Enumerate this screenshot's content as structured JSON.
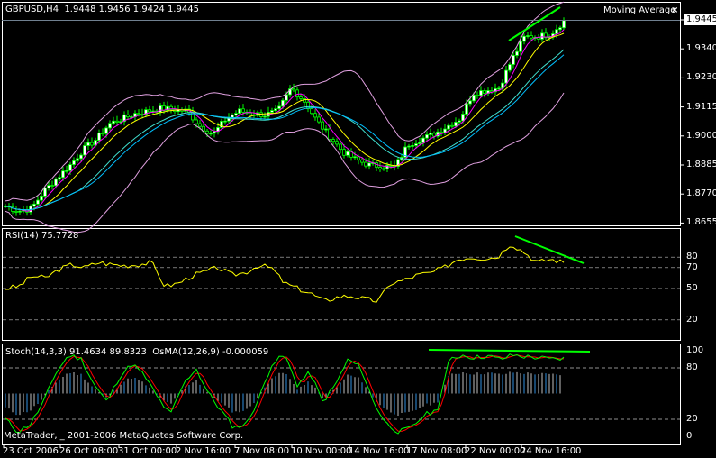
{
  "header": {
    "symbol": "GBPUSD,H4",
    "ohlc": "1.9448 1.9456 1.9424 1.9445",
    "indicator_label": "Moving Average",
    "close_icon": "close-icon"
  },
  "rsi_label": "RSI(14) 75.7728",
  "stoch_label": "Stoch(14,3,3) 91.4634 89.8323",
  "osma_label": "OsMA(12,26,9) -0.000059",
  "copyright": "MetaTrader, _ 2001-2006 MetaQuotes Software Corp.",
  "colors": {
    "bull": "#00ff00",
    "bands": "#e0a0e0",
    "ma_fast": "#ff00ff",
    "ma_mid": "#ffff00",
    "ma_slow": "#00c0ff",
    "rsi": "#ffff00",
    "stoch_main": "#00ff00",
    "stoch_signal": "#ff0000",
    "osma": "#c0c0c0",
    "trendline": "#00ff00"
  },
  "chart_data": [
    {
      "type": "candlestick",
      "title": "GBPUSD,H4",
      "current_price": "1.9445",
      "y_ticks": [
        "1.9445",
        "1.9340",
        "1.9230",
        "1.9115",
        "1.9000",
        "1.8885",
        "1.8770",
        "1.8655"
      ],
      "ylim": [
        1.8655,
        1.9445
      ],
      "x_ticks": [
        "23 Oct 2006",
        "26 Oct 08:00",
        "31 Oct 00:00",
        "2 Nov 16:00",
        "7 Nov 08:00",
        "10 Nov 00:00",
        "14 Nov 16:00",
        "17 Nov 08:00",
        "22 Nov 00:00",
        "24 Nov 16:00"
      ],
      "close_approx": [
        1.872,
        1.87,
        1.871,
        1.878,
        1.883,
        1.888,
        1.894,
        1.898,
        1.904,
        1.906,
        1.908,
        1.909,
        1.91,
        1.9095,
        1.909,
        1.903,
        1.9,
        1.906,
        1.909,
        1.908,
        1.9075,
        1.909,
        1.918,
        1.913,
        1.905,
        1.899,
        1.893,
        1.89,
        1.888,
        1.8875,
        1.887,
        1.896,
        1.898,
        1.9,
        1.903,
        1.906,
        1.916,
        1.917,
        1.918,
        1.929,
        1.938,
        1.938,
        1.939,
        1.944
      ],
      "overlays": [
        "Bollinger Bands",
        "Moving Average"
      ]
    },
    {
      "type": "line",
      "title": "RSI(14) 75.7728",
      "y_ticks": [
        "80",
        "70",
        "50",
        "20"
      ],
      "levels": [
        80,
        70,
        50,
        20
      ],
      "ylim": [
        0,
        100
      ],
      "values": [
        50,
        52,
        62,
        60,
        68,
        73,
        70,
        75,
        73,
        72,
        73,
        75,
        52,
        55,
        62,
        66,
        70,
        63,
        65,
        72,
        70,
        55,
        50,
        45,
        38,
        42,
        43,
        40,
        38,
        55,
        58,
        63,
        65,
        70,
        78,
        80,
        79,
        80,
        93,
        85,
        75,
        78,
        75
      ]
    },
    {
      "type": "line",
      "title": "Stoch(14,3,3) 91.4634 89.8323 / OsMA(12,26,9) -0.000059",
      "y_ticks": [
        "100",
        "80",
        "20",
        "0"
      ],
      "levels": [
        80,
        20
      ],
      "ylim": [
        0,
        100
      ],
      "values": [
        20,
        5,
        15,
        40,
        75,
        95,
        90,
        60,
        40,
        70,
        85,
        70,
        45,
        25,
        60,
        80,
        50,
        30,
        10,
        15,
        45,
        85,
        95,
        60,
        75,
        40,
        60,
        90,
        80,
        40,
        15,
        5,
        10,
        25,
        30,
        90,
        95,
        92,
        94,
        90,
        95,
        93,
        92,
        90,
        91
      ]
    }
  ]
}
